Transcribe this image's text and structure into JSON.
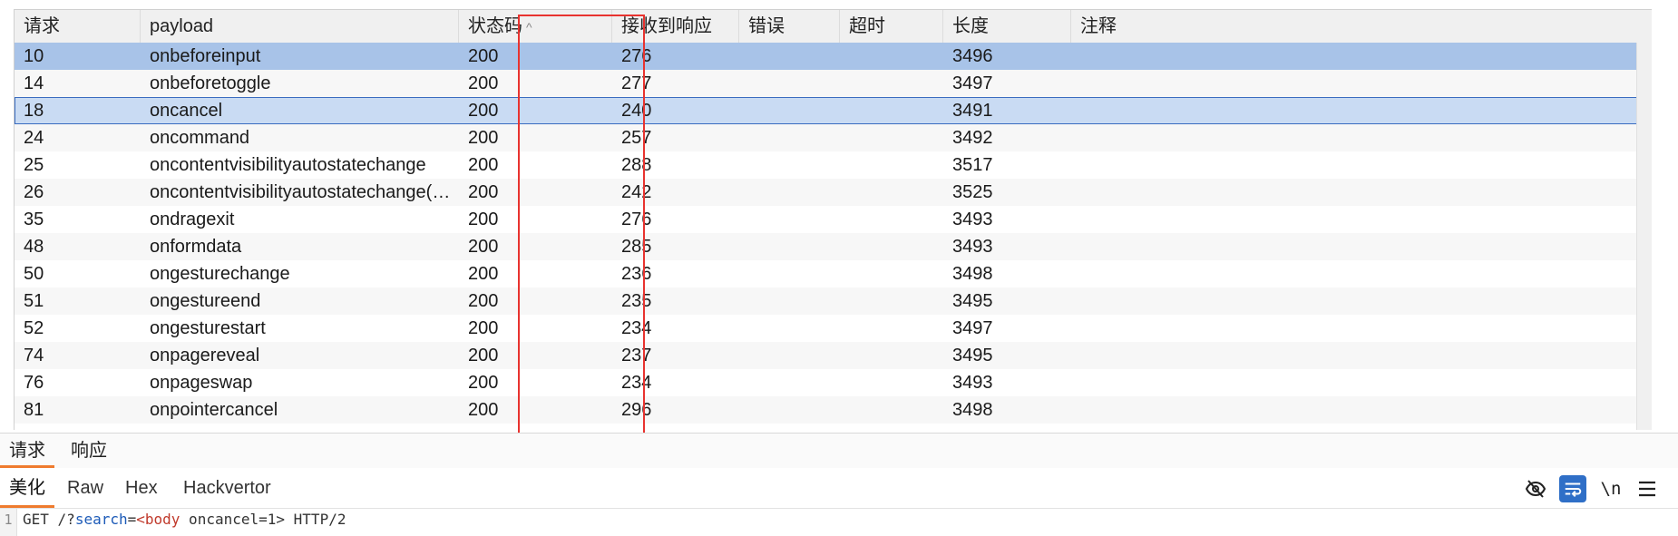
{
  "columns": [
    {
      "key": "req",
      "label": "请求"
    },
    {
      "key": "payload",
      "label": "payload"
    },
    {
      "key": "status",
      "label": "状态码"
    },
    {
      "key": "recv",
      "label": "接收到响应"
    },
    {
      "key": "error",
      "label": "错误"
    },
    {
      "key": "timeout",
      "label": "超时"
    },
    {
      "key": "length",
      "label": "长度"
    },
    {
      "key": "comment",
      "label": "注释"
    }
  ],
  "sort": {
    "column": "status",
    "direction": "ascending",
    "icon": "sort-up-icon"
  },
  "rows": [
    {
      "req": "10",
      "payload": "onbeforeinput",
      "status": "200",
      "recv": "276",
      "error": "",
      "timeout": "",
      "length": "3496",
      "comment": ""
    },
    {
      "req": "14",
      "payload": "onbeforetoggle",
      "status": "200",
      "recv": "277",
      "error": "",
      "timeout": "",
      "length": "3497",
      "comment": ""
    },
    {
      "req": "18",
      "payload": "oncancel",
      "status": "200",
      "recv": "240",
      "error": "",
      "timeout": "",
      "length": "3491",
      "comment": ""
    },
    {
      "req": "24",
      "payload": "oncommand",
      "status": "200",
      "recv": "257",
      "error": "",
      "timeout": "",
      "length": "3492",
      "comment": ""
    },
    {
      "req": "25",
      "payload": "oncontentvisibilityautostatechange",
      "status": "200",
      "recv": "288",
      "error": "",
      "timeout": "",
      "length": "3517",
      "comment": ""
    },
    {
      "req": "26",
      "payload": "oncontentvisibilityautostatechange(hidd...",
      "status": "200",
      "recv": "242",
      "error": "",
      "timeout": "",
      "length": "3525",
      "comment": ""
    },
    {
      "req": "35",
      "payload": "ondragexit",
      "status": "200",
      "recv": "276",
      "error": "",
      "timeout": "",
      "length": "3493",
      "comment": ""
    },
    {
      "req": "48",
      "payload": "onformdata",
      "status": "200",
      "recv": "285",
      "error": "",
      "timeout": "",
      "length": "3493",
      "comment": ""
    },
    {
      "req": "50",
      "payload": "ongesturechange",
      "status": "200",
      "recv": "236",
      "error": "",
      "timeout": "",
      "length": "3498",
      "comment": ""
    },
    {
      "req": "51",
      "payload": "ongestureend",
      "status": "200",
      "recv": "235",
      "error": "",
      "timeout": "",
      "length": "3495",
      "comment": ""
    },
    {
      "req": "52",
      "payload": "ongesturestart",
      "status": "200",
      "recv": "234",
      "error": "",
      "timeout": "",
      "length": "3497",
      "comment": ""
    },
    {
      "req": "74",
      "payload": "onpagereveal",
      "status": "200",
      "recv": "237",
      "error": "",
      "timeout": "",
      "length": "3495",
      "comment": ""
    },
    {
      "req": "76",
      "payload": "onpageswap",
      "status": "200",
      "recv": "234",
      "error": "",
      "timeout": "",
      "length": "3493",
      "comment": ""
    },
    {
      "req": "81",
      "payload": "onpointercancel",
      "status": "200",
      "recv": "296",
      "error": "",
      "timeout": "",
      "length": "3498",
      "comment": ""
    }
  ],
  "selected_row": "10",
  "focused_row": "18",
  "highlight_color": "#e8332f",
  "accent_color": "#ef7b2e",
  "tabs_main": [
    {
      "label": "请求",
      "active": true
    },
    {
      "label": "响应",
      "active": false
    }
  ],
  "tabs_sub": [
    {
      "label": "美化",
      "active": true
    },
    {
      "label": "Raw",
      "active": false
    },
    {
      "label": "Hex",
      "active": false
    },
    {
      "label": "Hackvertor",
      "active": false
    }
  ],
  "toolbar_icons": [
    "eye-off-icon",
    "wrap-lines-icon",
    "newline-icon",
    "menu-icon"
  ],
  "toolbar_newline_label": "\\n",
  "editor": {
    "line_number": "1",
    "method": "GET",
    "path_prefix": " /?",
    "param": "search",
    "equals": "=",
    "tag_open": "<body",
    "attr": " oncancel=1",
    "tag_close": ">",
    "protocol": " HTTP/2"
  }
}
